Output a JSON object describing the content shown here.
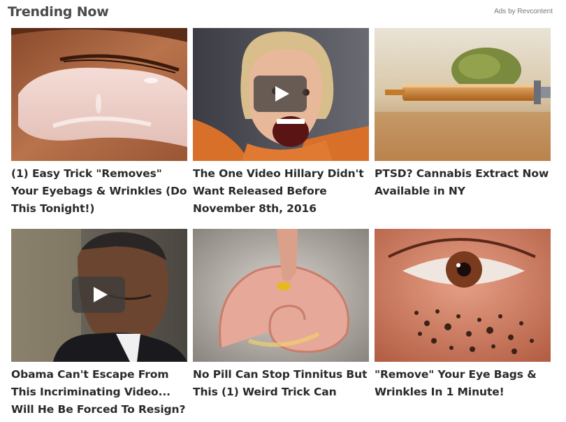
{
  "header": {
    "title": "Trending Now",
    "sponsor": "Ads by Revcontent"
  },
  "cards": [
    {
      "headline": "(1) Easy Trick \"Removes\" Your Eyebags & Wrinkles (Do This Tonight!)",
      "image": "under-eye-gel-patch",
      "video": false
    },
    {
      "headline": "The One Video Hillary Didn't Want Released Before November 8th, 2016",
      "image": "woman-orange-jacket-shouting",
      "video": true
    },
    {
      "headline": "PTSD? Cannabis Extract Now Available in NY",
      "image": "syringe-cannabis-extract",
      "video": false
    },
    {
      "headline": "Obama Can't Escape From This Incriminating Video... Will He Be Forced To Resign?",
      "image": "man-suit-head-down",
      "video": true
    },
    {
      "headline": "No Pill Can Stop Tinnitus But This (1) Weird Trick Can",
      "image": "finger-oil-drop-ear",
      "video": false
    },
    {
      "headline": "\"Remove\" Your Eye Bags & Wrinkles In 1 Minute!",
      "image": "eye-with-coffee-scrub",
      "video": false
    }
  ],
  "colors": {
    "title": "#4a4a4a",
    "headline": "#2a2a2a",
    "sponsor": "#777777",
    "play_button": "#3c3c3c"
  }
}
